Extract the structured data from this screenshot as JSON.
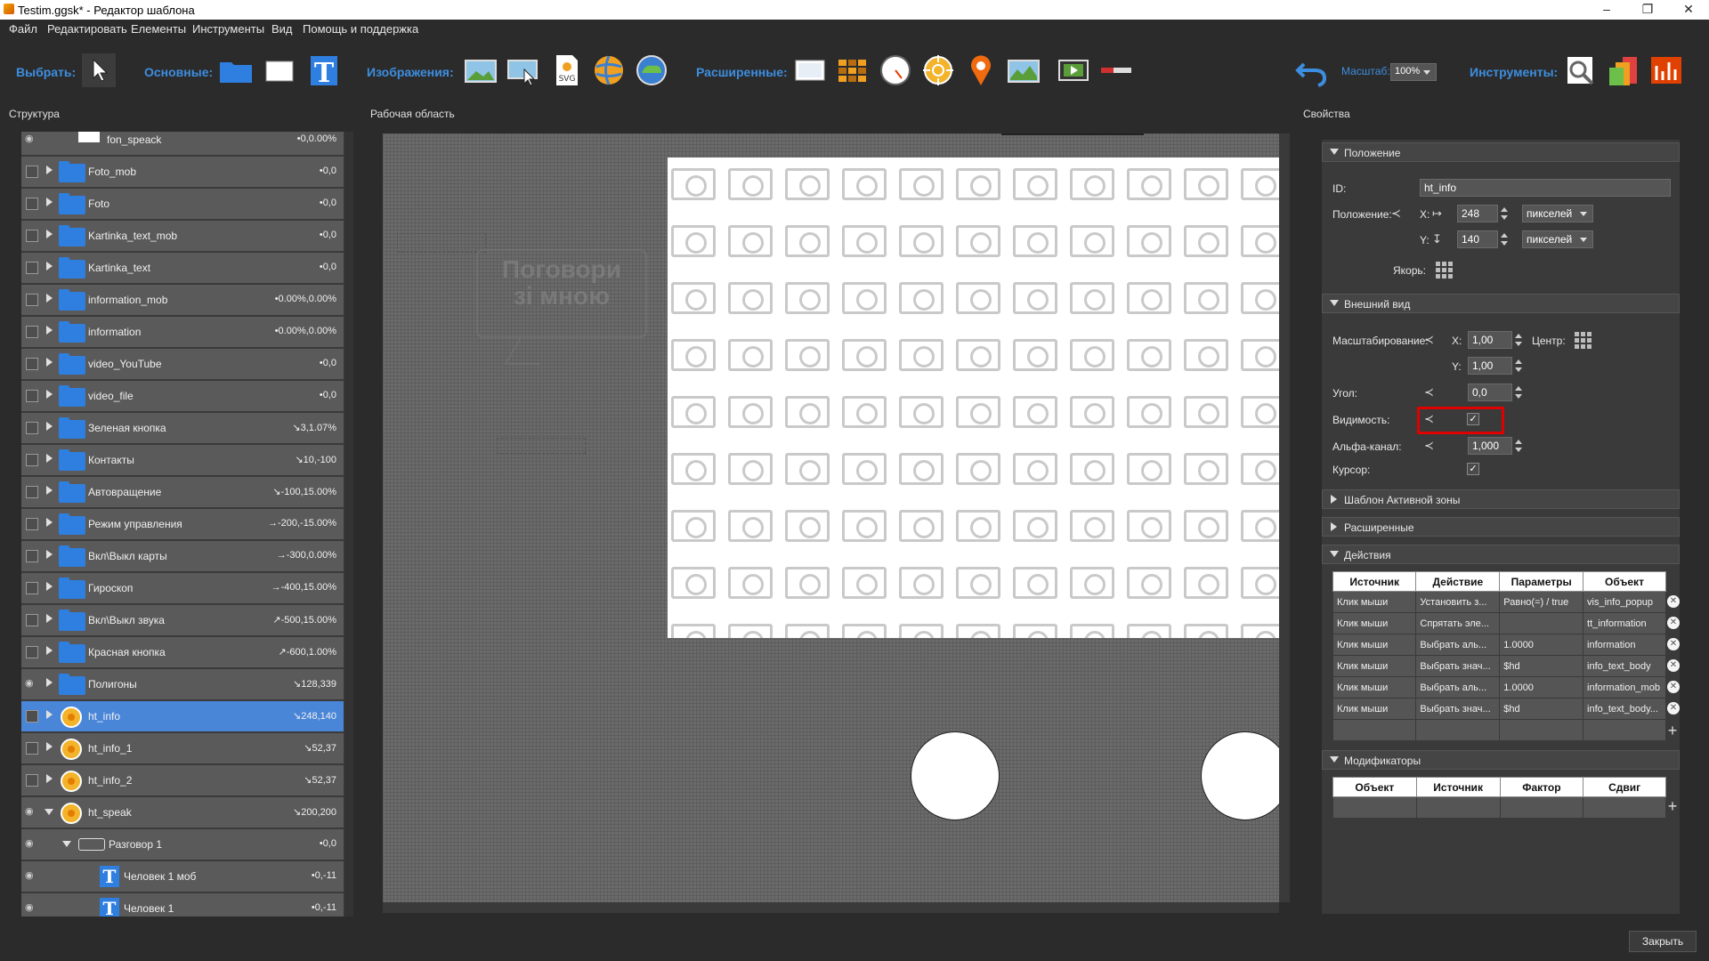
{
  "window": {
    "title": "Testim.ggsk* - Редактор шаблона"
  },
  "menu": [
    "Файл",
    "Редактировать",
    "Елементы",
    "Инструменты",
    "Вид",
    "Помощь и поддержка"
  ],
  "toolbar": {
    "select_label": "Выбрать:",
    "basic_label": "Основные:",
    "images_label": "Изображения:",
    "extended_label": "Расширенные:",
    "zoom_label": "Масштаб:",
    "zoom_value": "100%",
    "tools_label": "Инструменты:"
  },
  "panels": {
    "structure": "Структура",
    "workarea": "Рабочая область",
    "properties": "Свойства"
  },
  "tree": [
    {
      "name": "fon_speack",
      "value": "•0,0.00%",
      "vis": "eye",
      "icon": "white-rect"
    },
    {
      "name": "Foto_mob",
      "value": "•0,0",
      "vis": "box",
      "icon": "folder"
    },
    {
      "name": "Foto",
      "value": "•0,0",
      "vis": "box",
      "icon": "folder"
    },
    {
      "name": "Kartinka_text_mob",
      "value": "•0,0",
      "vis": "box",
      "icon": "folder"
    },
    {
      "name": "Kartinka_text",
      "value": "•0,0",
      "vis": "box",
      "icon": "folder"
    },
    {
      "name": "information_mob",
      "value": "•0.00%,0.00%",
      "vis": "box",
      "icon": "folder"
    },
    {
      "name": "information",
      "value": "•0.00%,0.00%",
      "vis": "box",
      "icon": "folder"
    },
    {
      "name": "video_YouTube",
      "value": "•0,0",
      "vis": "box",
      "icon": "folder"
    },
    {
      "name": "video_file",
      "value": "•0,0",
      "vis": "box",
      "icon": "folder"
    },
    {
      "name": "Зеленая кнопка",
      "value": "↘3,1.07%",
      "vis": "box",
      "icon": "folder"
    },
    {
      "name": "Контакты",
      "value": "↘10,-100",
      "vis": "box",
      "icon": "folder"
    },
    {
      "name": "Автовращение",
      "value": "↘-100,15.00%",
      "vis": "box",
      "icon": "folder"
    },
    {
      "name": "Режим управления",
      "value": "→-200,-15.00%",
      "vis": "box",
      "icon": "folder"
    },
    {
      "name": "Вкл\\Выкл карты",
      "value": "→-300,0.00%",
      "vis": "box",
      "icon": "folder"
    },
    {
      "name": "Гироскоп",
      "value": "→-400,15.00%",
      "vis": "box",
      "icon": "folder"
    },
    {
      "name": "Вкл\\Выкл звука",
      "value": "↗-500,15.00%",
      "vis": "box",
      "icon": "folder"
    },
    {
      "name": "Красная кнопка",
      "value": "↗-600,1.00%",
      "vis": "box",
      "icon": "folder"
    },
    {
      "name": "Полигоны",
      "value": "↘128,339",
      "vis": "eye",
      "icon": "folder"
    },
    {
      "name": "ht_info",
      "value": "↘248,140",
      "vis": "box",
      "icon": "hotspot",
      "selected": true
    },
    {
      "name": "ht_info_1",
      "value": "↘52,37",
      "vis": "box",
      "icon": "hotspot"
    },
    {
      "name": "ht_info_2",
      "value": "↘52,37",
      "vis": "box",
      "icon": "hotspot"
    },
    {
      "name": "ht_speak",
      "value": "↘200,200",
      "vis": "eye",
      "icon": "hotspot",
      "expanded": true
    },
    {
      "name": "Разговор 1",
      "value": "•0,0",
      "vis": "eye",
      "icon": "bubble",
      "expanded": true
    },
    {
      "name": "Человек 1 моб",
      "value": "•0,-11",
      "vis": "eye",
      "icon": "text"
    },
    {
      "name": "Человек 1",
      "value": "•0,-11",
      "vis": "eye",
      "icon": "text"
    }
  ],
  "work": {
    "ghost_text": "Поговори\nзі мною"
  },
  "props": {
    "sec_position": "Положение",
    "id_label": "ID:",
    "id_value": "ht_info",
    "position_label": "Положение:",
    "x_label": "X:",
    "x_value": "248",
    "y_label": "Y:",
    "y_value": "140",
    "unit_x": "пикселей",
    "unit_y": "пикселей",
    "anchor_label": "Якорь:",
    "sec_appearance": "Внешний вид",
    "scale_label": "Масштабирование:",
    "scale_x_label": "X:",
    "scale_x": "1,00",
    "scale_y_label": "Y:",
    "scale_y": "1,00",
    "center_label": "Центр:",
    "angle_label": "Угол:",
    "angle_value": "0,0",
    "visibility_label": "Видимость:",
    "alpha_label": "Альфа-канал:",
    "alpha_value": "1,000",
    "cursor_label": "Курсор:",
    "sec_hotspot_template": "Шаблон Активной зоны",
    "sec_extended": "Расширенные",
    "sec_actions": "Действия",
    "actions_headers": [
      "Источник",
      "Действие",
      "Параметры",
      "Объект"
    ],
    "actions": [
      [
        "Клик мыши",
        "Установить з...",
        "Равно(=) / true",
        "vis_info_popup"
      ],
      [
        "Клик мыши",
        "Спрятать эле...",
        "",
        "tt_information"
      ],
      [
        "Клик мыши",
        "Выбрать аль...",
        "1.0000",
        "information"
      ],
      [
        "Клик мыши",
        "Выбрать знач...",
        "$hd",
        "info_text_body"
      ],
      [
        "Клик мыши",
        "Выбрать аль...",
        "1.0000",
        "information_mob"
      ],
      [
        "Клик мыши",
        "Выбрать знач...",
        "$hd",
        "info_text_body..."
      ]
    ],
    "sec_modifiers": "Модификаторы",
    "modifiers_headers": [
      "Объект",
      "Источник",
      "Фактор",
      "Сдвиг"
    ]
  },
  "footer": {
    "close": "Закрыть"
  },
  "colors": {
    "accent": "#3d8ee0",
    "selected_row": "#4a86d8",
    "highlight": "#e00000"
  }
}
